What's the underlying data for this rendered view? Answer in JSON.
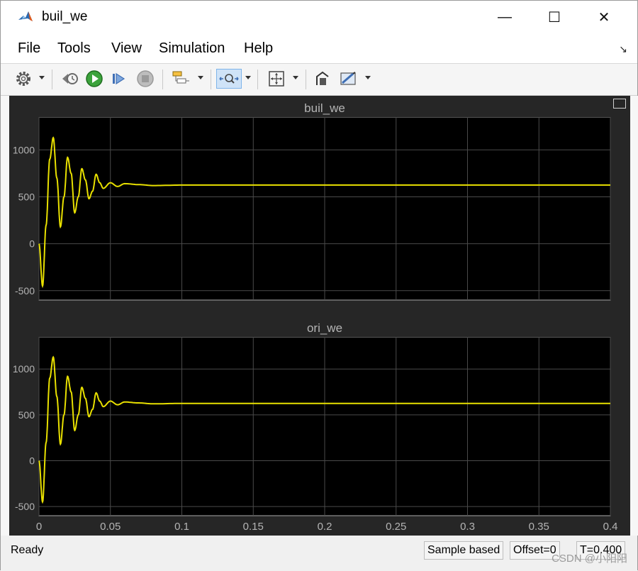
{
  "window": {
    "title": "buil_we",
    "controls": {
      "minimize": "—",
      "maximize": "☐",
      "close": "✕"
    }
  },
  "menu": {
    "items": [
      "File",
      "Tools",
      "View",
      "Simulation",
      "Help"
    ]
  },
  "toolbar": {
    "icons": [
      "gear-icon",
      "step-back-icon",
      "run-icon",
      "step-forward-icon",
      "stop-icon",
      "highlight-icon",
      "zoom-icon",
      "fit-icon",
      "write-data-icon",
      "style-icon"
    ]
  },
  "scope": {
    "plots": [
      {
        "title": "buil_we"
      },
      {
        "title": "ori_we"
      }
    ],
    "line_color": "#e8e000",
    "background": "#000000"
  },
  "chart_data": [
    {
      "type": "line",
      "title": "buil_we",
      "x_ticks": [],
      "y_ticks": [
        -500,
        0,
        500,
        1000
      ],
      "xlim": [
        0,
        0.4
      ],
      "ylim": [
        -600,
        1350
      ],
      "grid": true,
      "series": [
        {
          "values_x": [
            0,
            0.0025,
            0.005,
            0.0075,
            0.01,
            0.0125,
            0.015,
            0.0175,
            0.02,
            0.0225,
            0.025,
            0.0275,
            0.03,
            0.0325,
            0.035,
            0.0375,
            0.04,
            0.0425,
            0.045,
            0.05,
            0.055,
            0.06,
            0.07,
            0.08,
            0.1,
            0.15,
            0.4
          ],
          "values_y": [
            0,
            -450,
            200,
            900,
            1130,
            700,
            180,
            500,
            920,
            750,
            330,
            500,
            800,
            680,
            480,
            560,
            740,
            650,
            590,
            650,
            610,
            640,
            630,
            620,
            625,
            625,
            625
          ]
        }
      ]
    },
    {
      "type": "line",
      "title": "ori_we",
      "x_ticks": [
        0,
        0.05,
        0.1,
        0.15,
        0.2,
        0.25,
        0.3,
        0.35,
        0.4
      ],
      "x_tick_labels": [
        "0",
        "0.05",
        "0.1",
        "0.15",
        "0.2",
        "0.25",
        "0.3",
        "0.35",
        "0.4"
      ],
      "y_ticks": [
        -500,
        0,
        500,
        1000
      ],
      "xlim": [
        0,
        0.4
      ],
      "ylim": [
        -600,
        1350
      ],
      "grid": true,
      "series": [
        {
          "values_x": [
            0,
            0.0025,
            0.005,
            0.0075,
            0.01,
            0.0125,
            0.015,
            0.0175,
            0.02,
            0.0225,
            0.025,
            0.0275,
            0.03,
            0.0325,
            0.035,
            0.0375,
            0.04,
            0.0425,
            0.045,
            0.05,
            0.055,
            0.06,
            0.07,
            0.08,
            0.1,
            0.15,
            0.4
          ],
          "values_y": [
            0,
            -450,
            200,
            900,
            1130,
            700,
            180,
            500,
            920,
            750,
            330,
            500,
            800,
            680,
            480,
            560,
            740,
            650,
            590,
            650,
            610,
            640,
            630,
            620,
            625,
            625,
            625
          ]
        }
      ]
    }
  ],
  "status": {
    "ready": "Ready",
    "sample": "Sample based",
    "offset": "Offset=0",
    "time": "T=0.400"
  },
  "watermark": "CSDN @小阳阳"
}
